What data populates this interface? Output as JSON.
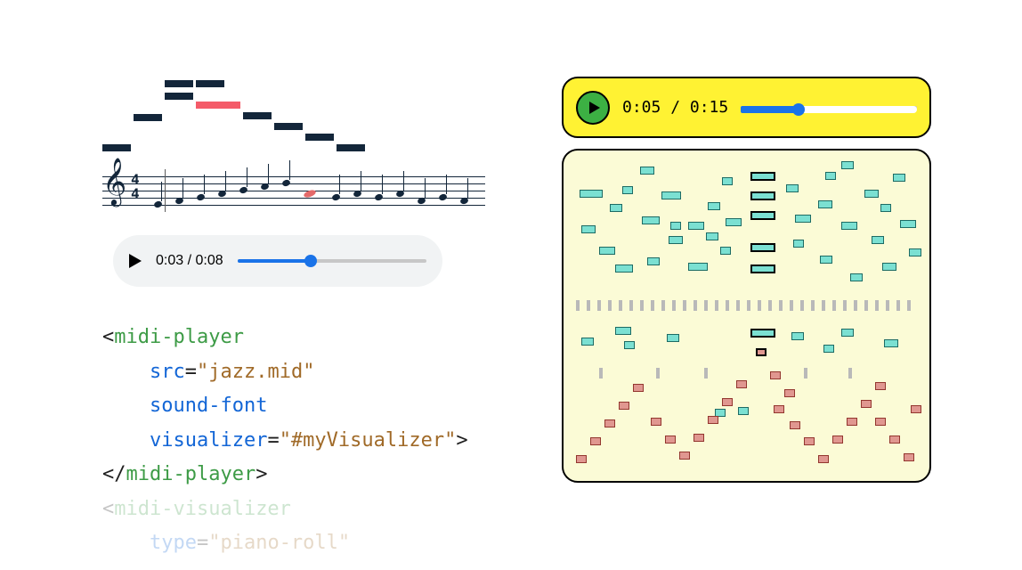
{
  "left": {
    "player": {
      "current": "0:03",
      "total": "0:08",
      "progress_pct": 39
    },
    "staff": {
      "timesig_top": "4",
      "timesig_bot": "4"
    },
    "code": {
      "l1_open": "<",
      "l1_tag": "midi-player",
      "l2_attr": "src",
      "l2_eq": "=",
      "l2_val": "\"jazz.mid\"",
      "l3_attr": "sound-font",
      "l4_attr": "visualizer",
      "l4_eq": "=",
      "l4_val": "\"#myVisualizer\"",
      "l4_close": ">",
      "l5_open": "</",
      "l5_tag": "midi-player",
      "l5_close": ">",
      "l6_open": "<",
      "l6_tag": "midi-visualizer",
      "l7_attr": "type",
      "l7_eq": "=",
      "l7_val": "\"piano-roll\""
    }
  },
  "right": {
    "player": {
      "current": "0:05",
      "total": "0:15",
      "progress_pct": 33
    }
  }
}
